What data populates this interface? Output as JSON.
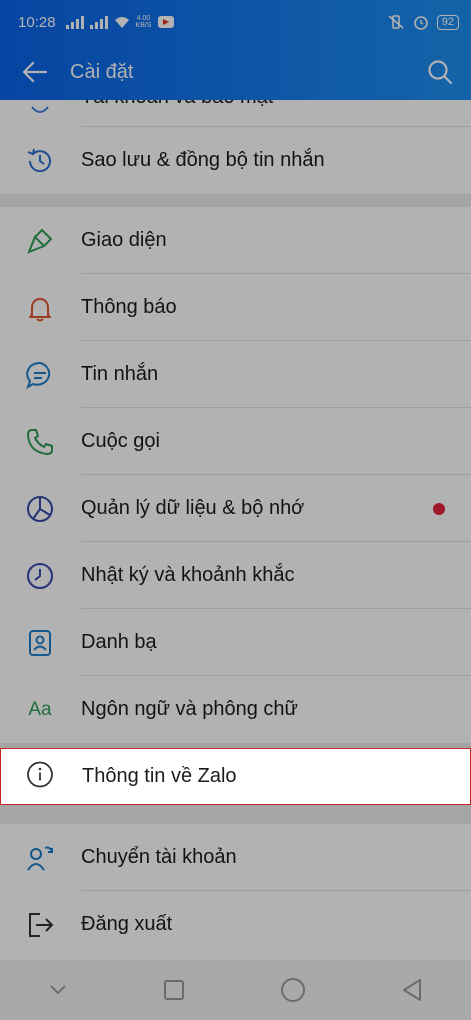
{
  "status_bar": {
    "time": "10:28",
    "net_speed_top": "4.00",
    "net_speed_bottom": "KB/S",
    "battery": "92"
  },
  "header": {
    "title": "Cài đặt"
  },
  "menu": {
    "partial_item": "Tài khoản và bảo mật",
    "backup": "Sao lưu & đồng bộ tin nhắn",
    "appearance": "Giao diện",
    "notifications": "Thông báo",
    "messages": "Tin nhắn",
    "calls": "Cuộc gọi",
    "data_storage": "Quản lý dữ liệu & bộ nhớ",
    "timeline": "Nhật ký và khoảnh khắc",
    "contacts": "Danh bạ",
    "language_font": "Ngôn ngữ và phông chữ",
    "language_icon_text": "Aa",
    "about": "Thông tin về Zalo",
    "switch_account": "Chuyển tài khoản",
    "logout": "Đăng xuất"
  },
  "colors": {
    "accent_blue": "#0a63e8",
    "highlight_border": "#c62828",
    "red_dot": "#e4213a"
  }
}
